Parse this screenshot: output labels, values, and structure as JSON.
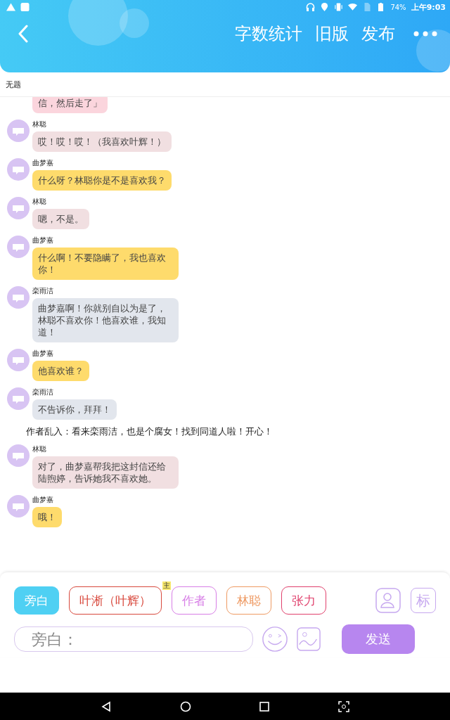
{
  "status_bar": {
    "battery": "74%",
    "time": "上午9:03"
  },
  "toolbar": {
    "actions": [
      "字数统计",
      "旧版",
      "发布"
    ]
  },
  "document": {
    "title": "无题"
  },
  "messages": [
    {
      "kind": "bubble",
      "text": "信，然后走了」",
      "color": "#fbd5dd"
    },
    {
      "kind": "bubble",
      "speaker": "林聪",
      "text": "哎！哎！哎！（我喜欢叶辉！）",
      "color": "#f1dfe1"
    },
    {
      "kind": "bubble",
      "speaker": "曲梦嘉",
      "text": "什么呀？林聪你是不是喜欢我？",
      "color": "#fedb6c"
    },
    {
      "kind": "bubble",
      "speaker": "林聪",
      "text": "嗯，不是。",
      "color": "#f1dfe1"
    },
    {
      "kind": "bubble",
      "speaker": "曲梦嘉",
      "text": "什么啊！不要隐瞒了，我也喜欢你！",
      "color": "#fedb6c"
    },
    {
      "kind": "bubble",
      "speaker": "栾雨洁",
      "text": "曲梦嘉啊！你就别自以为是了，林聪不喜欢你！他喜欢谁，我知道！",
      "color": "#e2e6ed"
    },
    {
      "kind": "bubble",
      "speaker": "曲梦嘉",
      "text": "他喜欢谁？",
      "color": "#fedb6c"
    },
    {
      "kind": "bubble",
      "speaker": "栾雨洁",
      "text": "不告诉你，拜拜！",
      "color": "#e2e6ed"
    },
    {
      "kind": "narration",
      "text": "作者乱入：看来栾雨洁，也是个腐女！找到同道人啦！开心！"
    },
    {
      "kind": "bubble",
      "speaker": "林聪",
      "text": "对了，曲梦嘉帮我把这封信还给陆煦婷，告诉她我不喜欢她。",
      "color": "#f1dfe1"
    },
    {
      "kind": "bubble",
      "speaker": "曲梦嘉",
      "text": "哦！",
      "color": "#fedb6c"
    }
  ],
  "roles": [
    {
      "label": "旁白",
      "selected": true,
      "color": "#4fd0f3"
    },
    {
      "label": "叶淅（叶辉）",
      "selected": false,
      "color": "#d8483c",
      "badge": "主"
    },
    {
      "label": "作者",
      "selected": false,
      "color": "#d77ee6"
    },
    {
      "label": "林聪",
      "selected": false,
      "color": "#ee9a63"
    },
    {
      "label": "张力",
      "selected": false,
      "color": "#e0406c"
    }
  ],
  "role_tool_label": "标",
  "composer": {
    "placeholder": "旁白：",
    "send": "发送"
  }
}
